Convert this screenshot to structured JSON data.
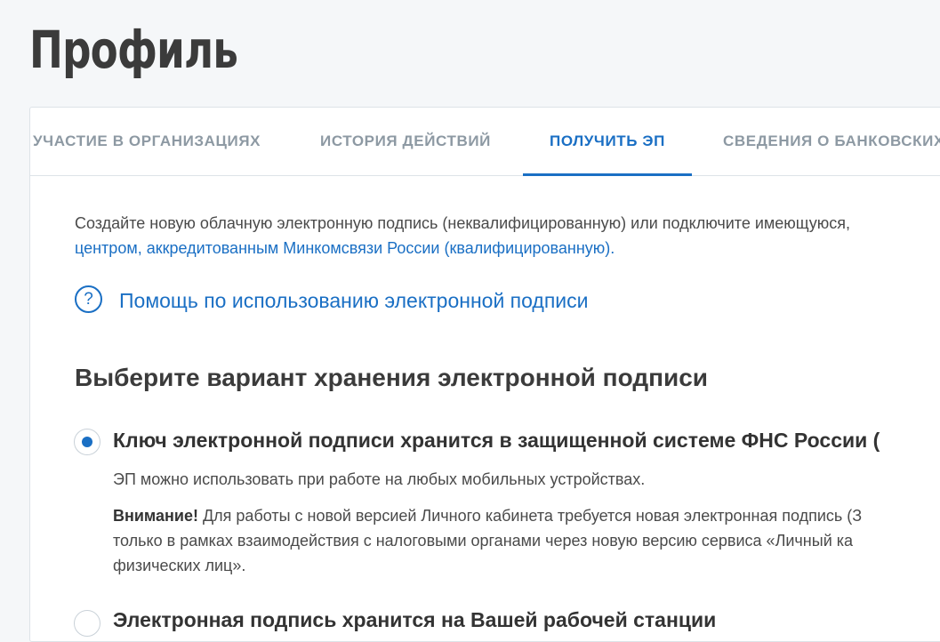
{
  "page": {
    "title": "Профиль"
  },
  "tabs": [
    {
      "label": "УЧАСТИЕ В ОРГАНИЗАЦИЯХ",
      "active": false
    },
    {
      "label": "ИСТОРИЯ ДЕЙСТВИЙ",
      "active": false
    },
    {
      "label": "ПОЛУЧИТЬ ЭП",
      "active": true
    },
    {
      "label": "СВЕДЕНИЯ О БАНКОВСКИХ",
      "active": false
    }
  ],
  "intro": {
    "text": "Создайте новую облачную электронную подпись (неквалифицированную) или подключите имеющуюся,",
    "link_text": "центром, аккредитованным Минкомсвязи России (квалифицированную)."
  },
  "help": {
    "icon": "question-circle-icon",
    "label": "Помощь по использованию электронной подписи"
  },
  "section": {
    "heading": "Выберите вариант хранения электронной подписи"
  },
  "options": [
    {
      "title": "Ключ электронной подписи хранится в защищенной системе ФНС России (",
      "selected": true,
      "description": "ЭП можно использовать при работе на любых мобильных устройствах.",
      "warning_label": "Внимание!",
      "warning_line1": "Для работы с новой версией Личного кабинета требуется новая электронная подпись (З",
      "warning_line2": "только в рамках взаимодействия с налоговыми органами через новую версию сервиса  «Личный ка",
      "warning_line3": "физических лиц»."
    },
    {
      "title": "Электронная подпись хранится на Вашей рабочей станции",
      "selected": false
    }
  ],
  "colors": {
    "accent": "#1a6fc4",
    "background": "#f5f7f9",
    "tab_inactive": "#8d99a3",
    "heading": "#3b3b3b"
  }
}
